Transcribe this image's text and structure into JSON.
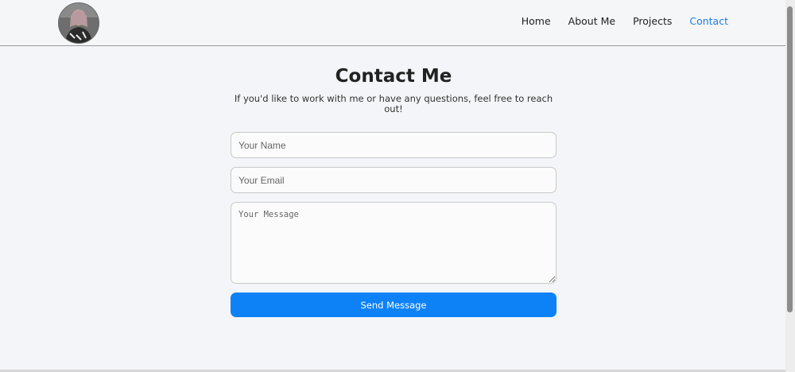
{
  "header": {
    "nav": [
      "Home",
      "About Me",
      "Projects",
      "Contact"
    ],
    "active": "Contact"
  },
  "contact": {
    "title": "Contact Me",
    "subtitle": "If you'd like to work with me or have any questions, feel free to reach out!",
    "name_placeholder": "Your Name",
    "email_placeholder": "Your Email",
    "message_placeholder": "Your Message",
    "send_label": "Send Message"
  },
  "colors": {
    "accent": "#0d82f7",
    "active_link": "#1a7fe6",
    "background": "#f4f5f8"
  }
}
